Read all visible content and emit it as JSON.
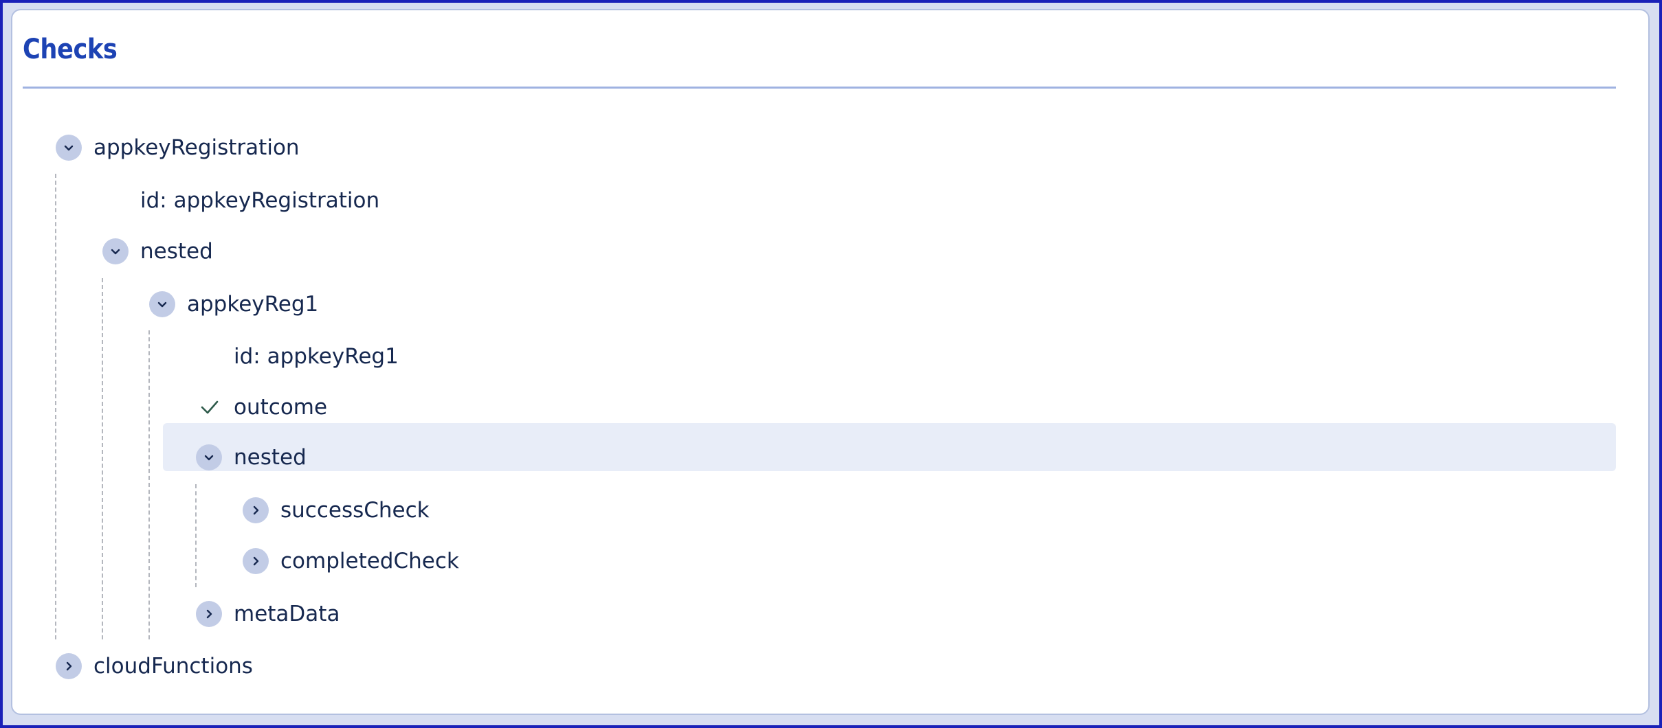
{
  "panel": {
    "title": "Checks"
  },
  "colors": {
    "title": "#1d43b4",
    "text": "#16284f",
    "toggle_bg": "#c2cce6",
    "highlight_bg": "#e8edf8",
    "divider": "#9fb2e1",
    "check": "#2d5a4a"
  },
  "tree": {
    "appkeyRegistration": {
      "label": "appkeyRegistration",
      "state": "expanded",
      "id_label": "id: appkeyRegistration",
      "nested": {
        "label": "nested",
        "state": "expanded",
        "appkeyReg1": {
          "label": "appkeyReg1",
          "state": "expanded",
          "id_label": "id: appkeyReg1",
          "outcome": {
            "label": "outcome",
            "icon": "check-icon"
          },
          "nested": {
            "label": "nested",
            "state": "expanded",
            "selected": true,
            "successCheck": {
              "label": "successCheck",
              "state": "collapsed"
            },
            "completedCheck": {
              "label": "completedCheck",
              "state": "collapsed"
            }
          },
          "metaData": {
            "label": "metaData",
            "state": "collapsed"
          }
        }
      }
    },
    "cloudFunctions": {
      "label": "cloudFunctions",
      "state": "collapsed"
    }
  },
  "icons": {
    "expanded": "chevron-down-icon",
    "collapsed": "chevron-right-icon",
    "outcome": "check-icon"
  }
}
